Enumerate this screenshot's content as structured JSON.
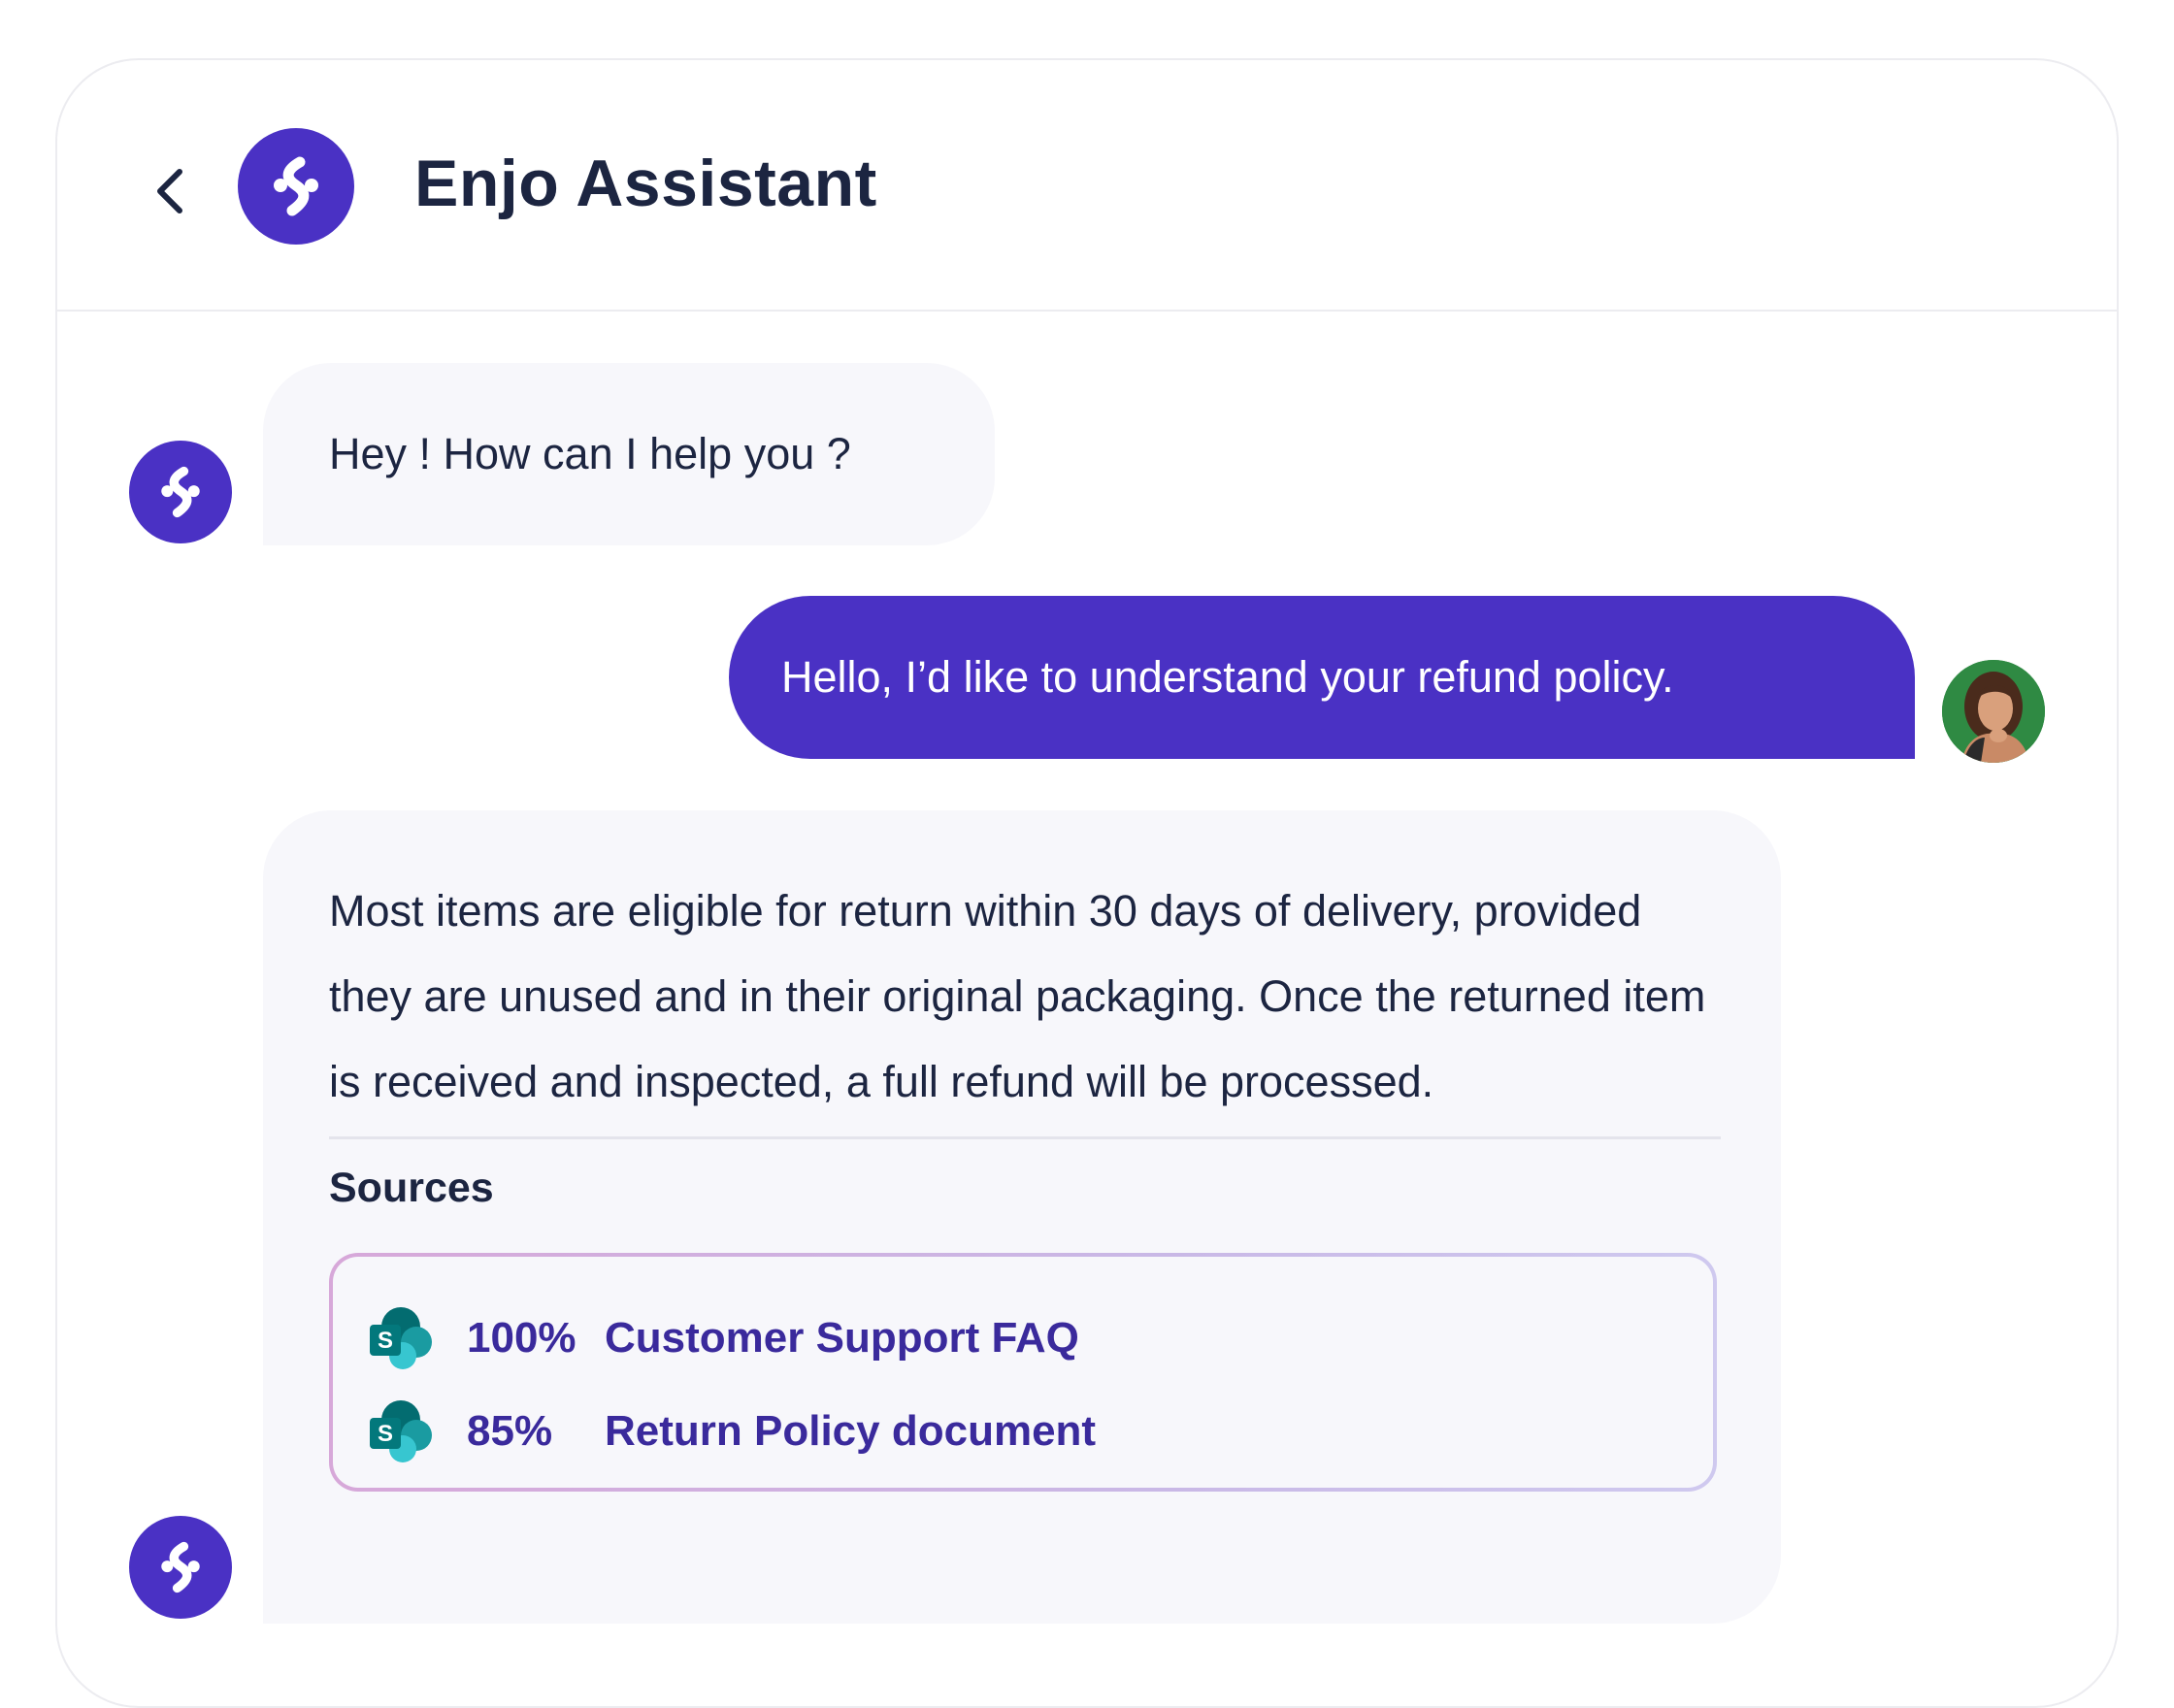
{
  "header": {
    "title": "Enjo Assistant",
    "back_icon": "chevron-left-icon",
    "avatar_icon": "enjo-logo-icon"
  },
  "colors": {
    "brand": "#4a31c4",
    "bot_bubble": "#f7f7fb",
    "text": "#1c2541",
    "source_link": "#3a2a9c"
  },
  "messages": [
    {
      "from": "bot",
      "text": "Hey ! How can I help you ?"
    },
    {
      "from": "user",
      "text": "Hello, I’d like to understand your refund policy."
    },
    {
      "from": "bot",
      "text": "Most items are eligible for return within 30 days of delivery, provided they are unused and in their original packaging. Once the returned item is received and inspected, a full refund will be processed.",
      "sources_title": "Sources",
      "sources": [
        {
          "icon": "sharepoint-icon",
          "percent": "100%",
          "name": "Customer Support FAQ"
        },
        {
          "icon": "sharepoint-icon",
          "percent": "85%",
          "name": "Return Policy document"
        }
      ]
    }
  ]
}
